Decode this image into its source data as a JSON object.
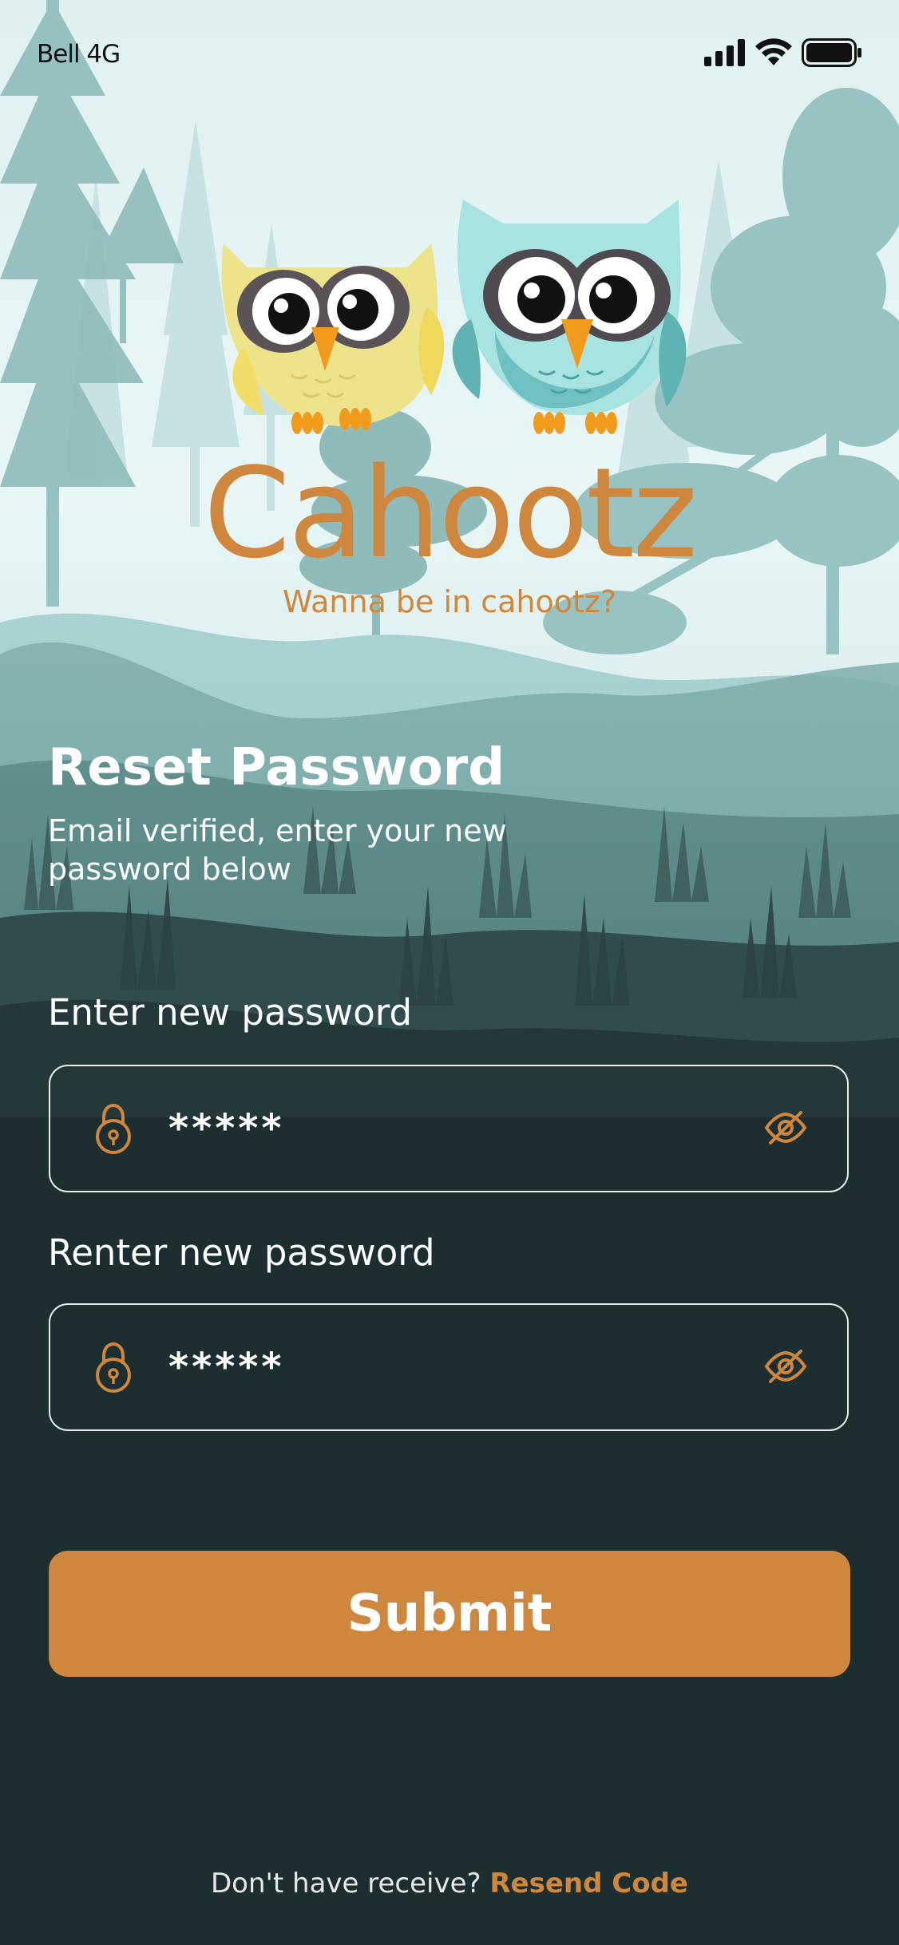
{
  "status_bar": {
    "carrier": "Bell 4G",
    "icons": [
      "signal-icon",
      "wifi-icon",
      "battery-icon"
    ]
  },
  "brand": {
    "name": "Cahootz",
    "tagline": "Wanna be in cahootz?",
    "mascot": "owl-pair-illustration"
  },
  "heading": {
    "title": "Reset Password",
    "subtitle": "Email verified, enter your new password below"
  },
  "form": {
    "new_password": {
      "label": "Enter new password",
      "value": "*****",
      "icon": "lock-icon",
      "toggle_icon": "eye-off-icon"
    },
    "confirm_password": {
      "label": "Renter new password",
      "value": "*****",
      "icon": "lock-icon",
      "toggle_icon": "eye-off-icon"
    },
    "submit_label": "Submit"
  },
  "footer": {
    "prompt": "Don't have receive? ",
    "link": "Resend Code"
  },
  "colors": {
    "accent": "#cf873e",
    "background_dark": "#1d2e31",
    "sky": "#e4f3f3",
    "owl_yellow": "#ece38a",
    "owl_teal": "#7fcfcf"
  }
}
